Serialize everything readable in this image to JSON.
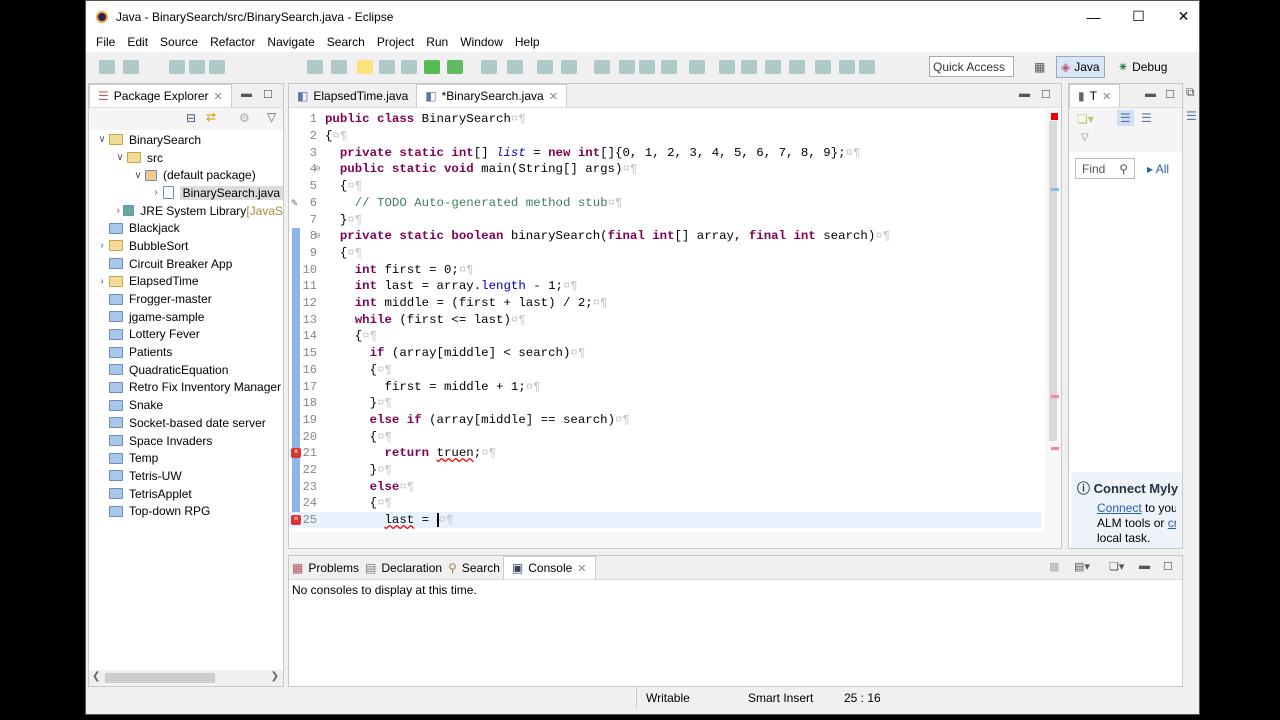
{
  "window": {
    "title": "Java - BinarySearch/src/BinarySearch.java - Eclipse"
  },
  "menu": [
    "File",
    "Edit",
    "Source",
    "Refactor",
    "Navigate",
    "Search",
    "Project",
    "Run",
    "Window",
    "Help"
  ],
  "toolbar": {
    "quick_access": "Quick Access",
    "perspectives": [
      "Java",
      "Debug"
    ]
  },
  "package_explorer": {
    "title": "Package Explorer",
    "items": [
      {
        "label": "BinarySearch",
        "level": 0,
        "chev": "v",
        "open": true
      },
      {
        "label": "src",
        "level": 1,
        "chev": "v",
        "open": true
      },
      {
        "label": "(default package)",
        "level": 2,
        "chev": "v"
      },
      {
        "label": "BinarySearch.java",
        "level": 3,
        "chev": ">",
        "selected": true
      },
      {
        "label": "JRE System Library",
        "suffix": " [JavaS",
        "level": 1,
        "chev": ">"
      },
      {
        "label": "Blackjack",
        "level": 0,
        "chev": ""
      },
      {
        "label": "BubbleSort",
        "level": 0,
        "chev": ">",
        "open": true
      },
      {
        "label": "Circuit Breaker App",
        "level": 0,
        "chev": ""
      },
      {
        "label": "ElapsedTime",
        "level": 0,
        "chev": ">",
        "open": true
      },
      {
        "label": "Frogger-master",
        "level": 0,
        "chev": ""
      },
      {
        "label": "jgame-sample",
        "level": 0,
        "chev": ""
      },
      {
        "label": "Lottery Fever",
        "level": 0,
        "chev": ""
      },
      {
        "label": "Patients",
        "level": 0,
        "chev": ""
      },
      {
        "label": "QuadraticEquation",
        "level": 0,
        "chev": ""
      },
      {
        "label": "Retro Fix Inventory Manager",
        "level": 0,
        "chev": ""
      },
      {
        "label": "Snake",
        "level": 0,
        "chev": ""
      },
      {
        "label": "Socket-based date server",
        "level": 0,
        "chev": ""
      },
      {
        "label": "Space Invaders",
        "level": 0,
        "chev": ""
      },
      {
        "label": "Temp",
        "level": 0,
        "chev": ""
      },
      {
        "label": "Tetris-UW",
        "level": 0,
        "chev": ""
      },
      {
        "label": "TetrisApplet",
        "level": 0,
        "chev": ""
      },
      {
        "label": "Top-down RPG",
        "level": 0,
        "chev": ""
      }
    ]
  },
  "editor": {
    "tabs": [
      {
        "label": "ElapsedTime.java",
        "active": false
      },
      {
        "label": "*BinarySearch.java",
        "active": true
      }
    ],
    "lines": [
      [
        [
          "kw",
          "public class "
        ],
        [
          "t",
          "BinarySearch"
        ]
      ],
      [
        [
          "t",
          "{"
        ]
      ],
      [
        [
          "t",
          "  "
        ],
        [
          "kw",
          "private static int"
        ],
        [
          "t",
          "[] "
        ],
        [
          "fi",
          "list"
        ],
        [
          "t",
          " = "
        ],
        [
          "kw",
          "new int"
        ],
        [
          "t",
          "[]{0, 1, 2, 3, 4, 5, 6, 7, 8, 9};"
        ]
      ],
      [
        [
          "t",
          "  "
        ],
        [
          "kw",
          "public static void"
        ],
        [
          "t",
          " main(String[] args)"
        ]
      ],
      [
        [
          "t",
          "  {"
        ]
      ],
      [
        [
          "t",
          "    "
        ],
        [
          "cm",
          "// TODO Auto-generated method stub"
        ]
      ],
      [
        [
          "t",
          "  }"
        ]
      ],
      [
        [
          "t",
          "  "
        ],
        [
          "kw",
          "private static boolean"
        ],
        [
          "t",
          " binarySearch("
        ],
        [
          "kw",
          "final int"
        ],
        [
          "t",
          "[] array, "
        ],
        [
          "kw",
          "final int"
        ],
        [
          "t",
          " search)"
        ]
      ],
      [
        [
          "t",
          "  {"
        ]
      ],
      [
        [
          "t",
          "    "
        ],
        [
          "kw",
          "int"
        ],
        [
          "t",
          " first = 0;"
        ]
      ],
      [
        [
          "t",
          "    "
        ],
        [
          "kw",
          "int"
        ],
        [
          "t",
          " last = array."
        ],
        [
          "fld",
          "length"
        ],
        [
          "t",
          " - 1;"
        ]
      ],
      [
        [
          "t",
          "    "
        ],
        [
          "kw",
          "int"
        ],
        [
          "t",
          " middle = (first + last) / 2;"
        ]
      ],
      [
        [
          "t",
          "    "
        ],
        [
          "kw",
          "while"
        ],
        [
          "t",
          " (first <= last)"
        ]
      ],
      [
        [
          "t",
          "    {"
        ]
      ],
      [
        [
          "t",
          "      "
        ],
        [
          "kw",
          "if"
        ],
        [
          "t",
          " (array[middle] < search)"
        ]
      ],
      [
        [
          "t",
          "      {"
        ]
      ],
      [
        [
          "t",
          "        first = middle + 1;"
        ]
      ],
      [
        [
          "t",
          "      }"
        ]
      ],
      [
        [
          "t",
          "      "
        ],
        [
          "kw",
          "else if"
        ],
        [
          "t",
          " (array[middle] == search)"
        ]
      ],
      [
        [
          "t",
          "      {"
        ]
      ],
      [
        [
          "t",
          "        "
        ],
        [
          "kw",
          "return"
        ],
        [
          "t",
          " "
        ],
        [
          "err",
          "truen"
        ],
        [
          "t",
          ";"
        ]
      ],
      [
        [
          "t",
          "      }"
        ]
      ],
      [
        [
          "t",
          "      "
        ],
        [
          "kw",
          "else"
        ]
      ],
      [
        [
          "t",
          "      {"
        ]
      ],
      [
        [
          "t",
          "        "
        ],
        [
          "err",
          "last"
        ],
        [
          "t",
          " = "
        ]
      ]
    ]
  },
  "task_list": {
    "tab": "T",
    "find_placeholder": "Find",
    "all_label": "All",
    "mylyn": {
      "title": "Connect Myly",
      "link1": "Connect",
      "text1": " to your",
      "text2": "ALM tools or ",
      "link2": "cre",
      "text3": "local task."
    }
  },
  "bottom": {
    "tabs": [
      "Problems",
      "Declaration",
      "Search",
      "Console"
    ],
    "active": "Console",
    "message": "No consoles to display at this time."
  },
  "status": {
    "writable": "Writable",
    "insert_mode": "Smart Insert",
    "position": "25 : 16"
  }
}
